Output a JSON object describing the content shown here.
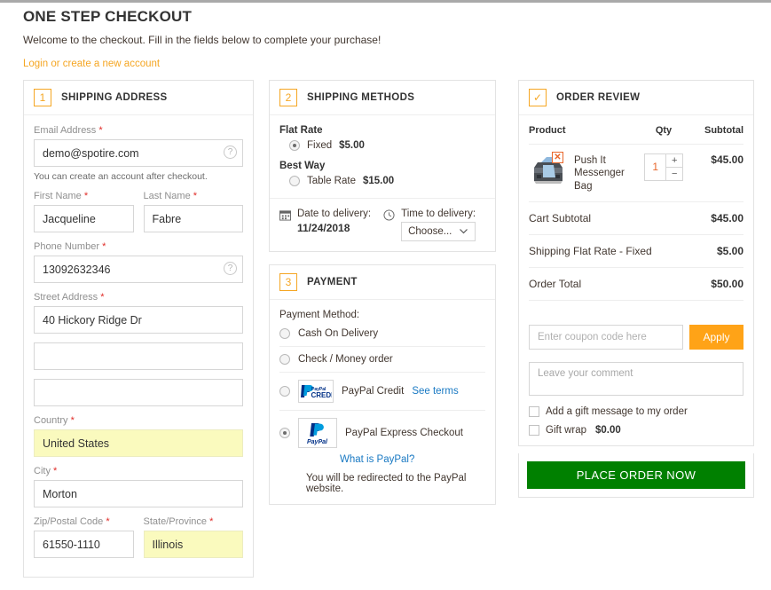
{
  "page": {
    "title": "ONE STEP CHECKOUT",
    "subtitle": "Welcome to the checkout. Fill in the fields below to complete your purchase!",
    "login_link": "Login or create a new account"
  },
  "shipping_address": {
    "step": "1",
    "title": "SHIPPING ADDRESS",
    "email": {
      "label": "Email Address",
      "value": "demo@spotire.com",
      "required": "*",
      "help": "?"
    },
    "email_hint": "You can create an account after checkout.",
    "first_name": {
      "label": "First Name",
      "value": "Jacqueline",
      "required": "*"
    },
    "last_name": {
      "label": "Last Name",
      "value": "Fabre",
      "required": "*"
    },
    "phone": {
      "label": "Phone Number",
      "value": "13092632346",
      "required": "*",
      "help": "?"
    },
    "street1": {
      "label": "Street Address",
      "value": "40 Hickory Ridge Dr",
      "required": "*"
    },
    "street2": {
      "value": ""
    },
    "street3": {
      "value": ""
    },
    "country": {
      "label": "Country",
      "value": "United States",
      "required": "*"
    },
    "city": {
      "label": "City",
      "value": "Morton",
      "required": "*"
    },
    "zip": {
      "label": "Zip/Postal Code",
      "value": "61550-1110",
      "required": "*"
    },
    "state": {
      "label": "State/Province",
      "value": "Illinois",
      "required": "*"
    }
  },
  "shipping_methods": {
    "step": "2",
    "title": "SHIPPING METHODS",
    "groups": [
      {
        "name": "Flat Rate",
        "option_label": "Fixed",
        "price": "$5.00",
        "selected": true
      },
      {
        "name": "Best Way",
        "option_label": "Table Rate",
        "price": "$15.00",
        "selected": false
      }
    ],
    "date_label": "Date to delivery:",
    "date_value": "11/24/2018",
    "time_label": "Time to delivery:",
    "time_value": "Choose..."
  },
  "payment": {
    "step": "3",
    "title": "PAYMENT",
    "method_label": "Payment Method:",
    "options": [
      {
        "label": "Cash On Delivery",
        "selected": false
      },
      {
        "label": "Check / Money order",
        "selected": false
      },
      {
        "label": "PayPal Credit",
        "selected": false,
        "logo": "paypal-credit-logo",
        "link": "See terms"
      },
      {
        "label": "PayPal Express Checkout",
        "selected": true,
        "logo": "paypal-logo",
        "link": "What is PayPal?"
      }
    ],
    "redirect_note": "You will be redirected to the PayPal website."
  },
  "order_review": {
    "step_check": "✓",
    "title": "ORDER REVIEW",
    "columns": {
      "product": "Product",
      "qty": "Qty",
      "subtotal": "Subtotal"
    },
    "items": [
      {
        "name": "Push It Messenger Bag",
        "qty": "1",
        "subtotal": "$45.00",
        "remove": "✕",
        "plus": "+",
        "minus": "−"
      }
    ],
    "totals": [
      {
        "label": "Cart Subtotal",
        "value": "$45.00"
      },
      {
        "label": "Shipping Flat Rate - Fixed",
        "value": "$5.00"
      },
      {
        "label": "Order Total",
        "value": "$50.00"
      }
    ],
    "coupon_placeholder": "Enter coupon code here",
    "coupon_value": "",
    "apply_label": "Apply",
    "comment_placeholder": "Leave your comment",
    "comment_value": "",
    "gift_message_label": "Add a gift message to my order",
    "gift_wrap_label": "Gift wrap",
    "gift_wrap_price": "$0.00",
    "place_order_label": "PLACE ORDER NOW"
  },
  "colors": {
    "accent_orange": "#f5a623",
    "apply_orange": "#ffa317",
    "order_green": "#008000",
    "link_blue": "#1979c3",
    "required_red": "#e02b27",
    "highlight_yellow": "#fafabe"
  }
}
